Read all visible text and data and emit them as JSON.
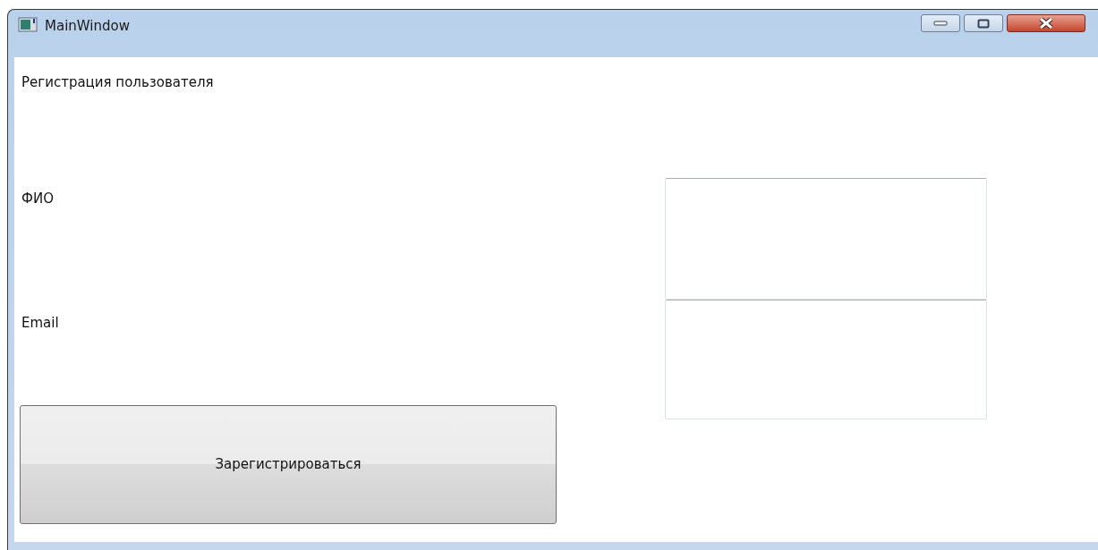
{
  "window": {
    "title": "MainWindow"
  },
  "heading": "Регистрация пользователя",
  "fields": [
    {
      "label": "ФИО"
    },
    {
      "label": "Email"
    }
  ],
  "button": "Зарегистрироваться"
}
